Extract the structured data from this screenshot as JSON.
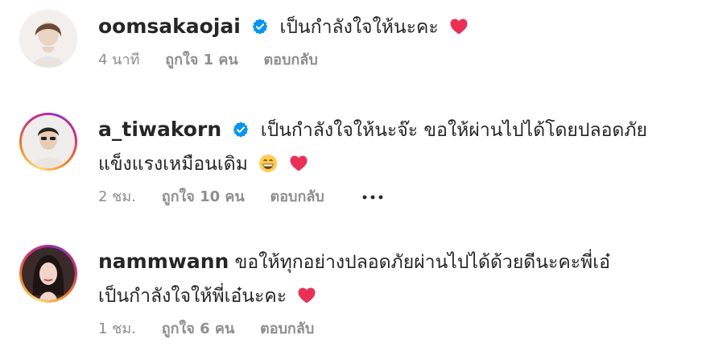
{
  "comments": [
    {
      "username": "oomsakaojai",
      "verified": true,
      "lines": [
        "เป็นกำลังใจให้นะคะ"
      ],
      "time": "4 นาที",
      "likes": "ถูกใจ 1 คน",
      "reply": "ตอบกลับ",
      "avatar_style": "plain"
    },
    {
      "username": "a_tiwakorn",
      "verified": true,
      "lines": [
        "เป็นกำลังใจให้นะจ๊ะ ขอให้ผ่านไปได้โดยปลอดภัย",
        "แข็งแรงเหมือนเดิม"
      ],
      "time": "2 ชม.",
      "likes": "ถูกใจ 10 คน",
      "reply": "ตอบกลับ",
      "avatar_style": "story",
      "more": "more-options-icon"
    },
    {
      "username": "nammwann",
      "verified": false,
      "lines": [
        "ขอให้ทุกอย่างปลอดภัยผ่านไปได้ด้วยดีนะคะพี่เอ๋",
        "เป็นกำลังใจให้พี่เอ๋นะคะ"
      ],
      "time": "1 ชม.",
      "likes": "ถูกใจ 6 คน",
      "reply": "ตอบกลับ",
      "avatar_style": "story"
    }
  ],
  "icons": {
    "verified": "verified-badge-icon",
    "heart": "red-heart-emoji",
    "grin": "grinning-face-emoji",
    "more": "more-options-icon"
  },
  "colors": {
    "text": "#262626",
    "meta": "#8e8e8e",
    "verified": "#0095f6",
    "heart": "#ed2f56"
  }
}
